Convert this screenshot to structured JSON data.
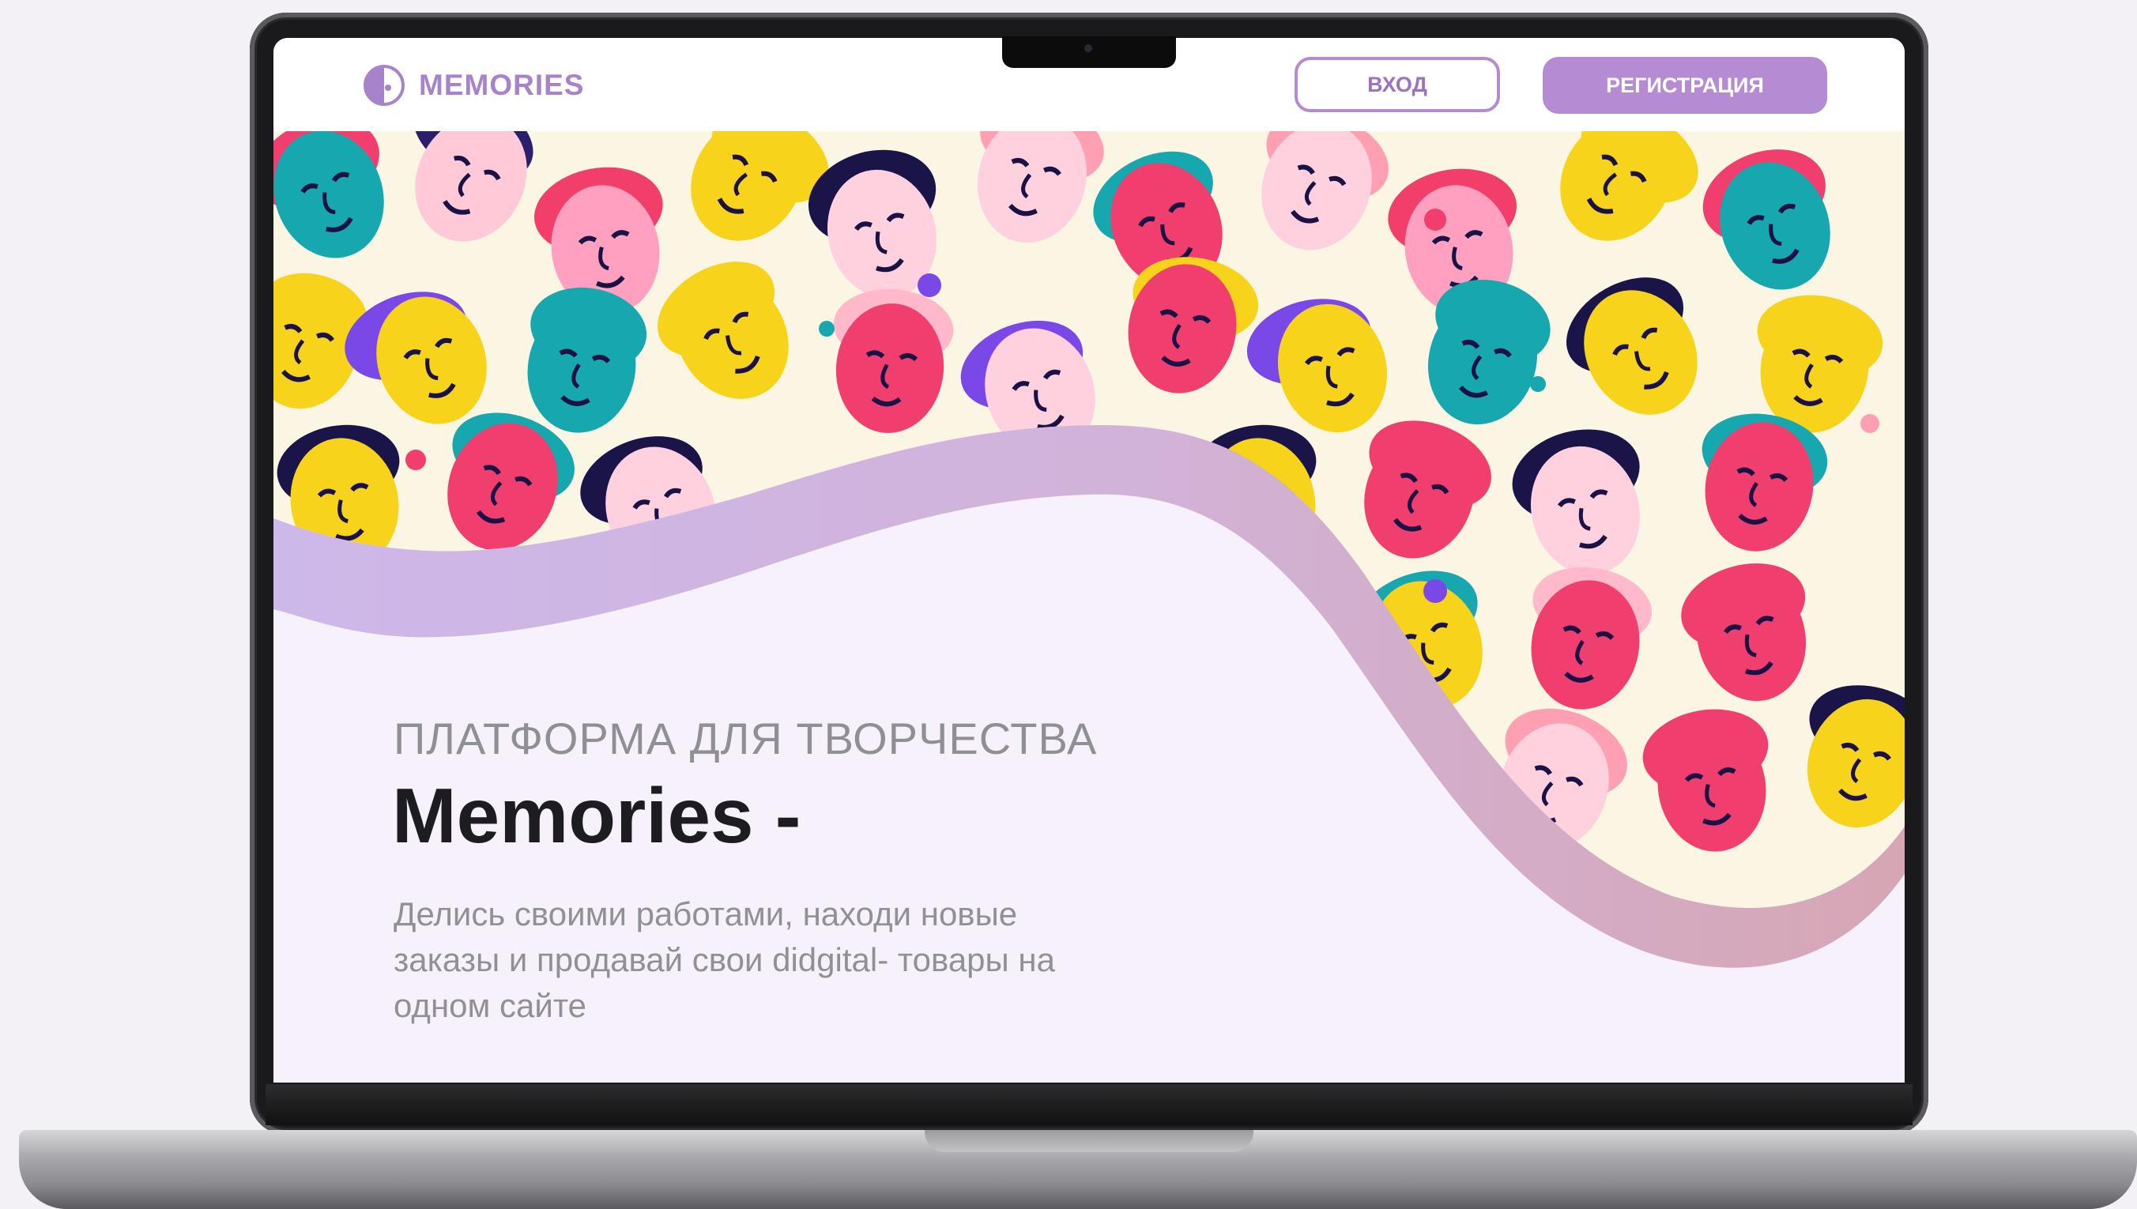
{
  "site": {
    "logo_text": "MEMORIES",
    "login_label": "ВХОД",
    "register_label": "РЕГИСТРАЦИЯ"
  },
  "hero": {
    "subtitle": "ПЛАТФОРМА ДЛЯ ТВОРЧЕСТВА",
    "title": "Memories -",
    "description": "Делись своими работами, находи новые заказы и продавай свои didgital- товары на одном сайте"
  },
  "colors": {
    "brand": "#a783cc",
    "button_fill": "#b58bd3",
    "page_bg": "#f7f1fb",
    "pattern_bg": "#fbf6e4",
    "wave_start": "#cdb8ea",
    "wave_end": "#d6a6b4"
  },
  "icons": {
    "logo": "memories-half-circle-logo-icon"
  }
}
